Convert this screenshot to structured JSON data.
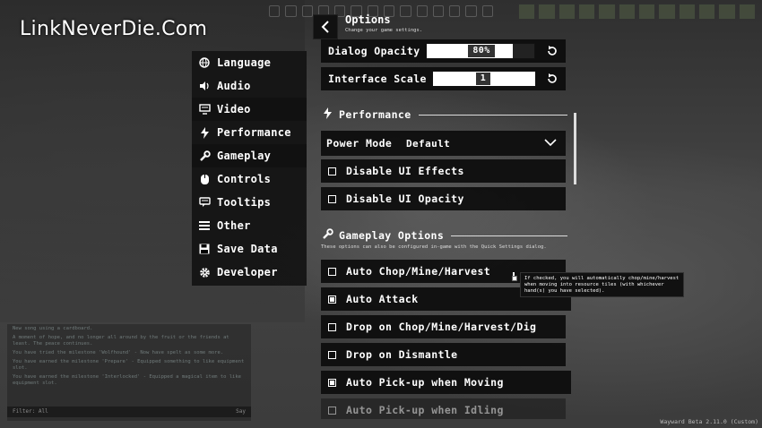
{
  "watermark": "LinkNeverDie.Com",
  "header": {
    "title": "Options",
    "subtitle": "Change your game settings."
  },
  "menu": {
    "items": [
      {
        "label": "Language",
        "icon": "globe-icon"
      },
      {
        "label": "Audio",
        "icon": "speaker-icon"
      },
      {
        "label": "Video",
        "icon": "monitor-icon"
      },
      {
        "label": "Performance",
        "icon": "lightning-icon"
      },
      {
        "label": "Gameplay",
        "icon": "wrench-icon"
      },
      {
        "label": "Controls",
        "icon": "mouse-icon"
      },
      {
        "label": "Tooltips",
        "icon": "speech-bubble-icon"
      },
      {
        "label": "Other",
        "icon": "list-icon"
      },
      {
        "label": "Save Data",
        "icon": "floppy-disk-icon"
      },
      {
        "label": "Developer",
        "icon": "gear-icon"
      }
    ],
    "active_index": 2
  },
  "settings": {
    "dialog_opacity": {
      "label": "Dialog Opacity",
      "value": "80%",
      "fraction": 0.8
    },
    "interface_scale": {
      "label": "Interface Scale",
      "value": "1",
      "fraction": 0.5
    }
  },
  "performance": {
    "heading": "Performance",
    "power_mode": {
      "label": "Power Mode",
      "value": "Default"
    },
    "disable_ui_effects": {
      "label": "Disable UI Effects",
      "checked": false
    },
    "disable_ui_opacity": {
      "label": "Disable UI Opacity",
      "checked": false
    }
  },
  "gameplay": {
    "heading": "Gameplay Options",
    "note": "These options can also be configured in-game with the Quick Settings dialog.",
    "options": [
      {
        "label": "Auto Chop/Mine/Harvest",
        "checked": false
      },
      {
        "label": "Auto Attack",
        "checked": true
      },
      {
        "label": "Drop on Chop/Mine/Harvest/Dig",
        "checked": false
      },
      {
        "label": "Drop on Dismantle",
        "checked": false
      },
      {
        "label": "Auto Pick-up when Moving",
        "checked": true
      },
      {
        "label": "Auto Pick-up when Idling",
        "checked": false
      }
    ]
  },
  "tooltip": {
    "text": "If checked, you will automatically chop/mine/harvest when moving into resource tiles (with whichever hand(s) you have selected)."
  },
  "chat": {
    "lines": [
      "New song using a cardboard.",
      "A moment of hope, and no longer all around by the fruit or the friends at least. The peace continues.",
      "You have tried the milestone 'Wolfhound' - Now have spelt as some more.",
      "You have earned the milestone 'Prepare' - Equipped something to like equipment slot.",
      "You have earned the milestone 'Interlocked' - Equipped a magical item to like equipment slot."
    ],
    "input_placeholder": "Filter: All",
    "input_right": "Say"
  },
  "version": "Wayward Beta 2.11.0 (Custom)",
  "colors": {
    "panel": "#0c0c0c",
    "menu_active": "#111111",
    "text": "#ffffff"
  }
}
